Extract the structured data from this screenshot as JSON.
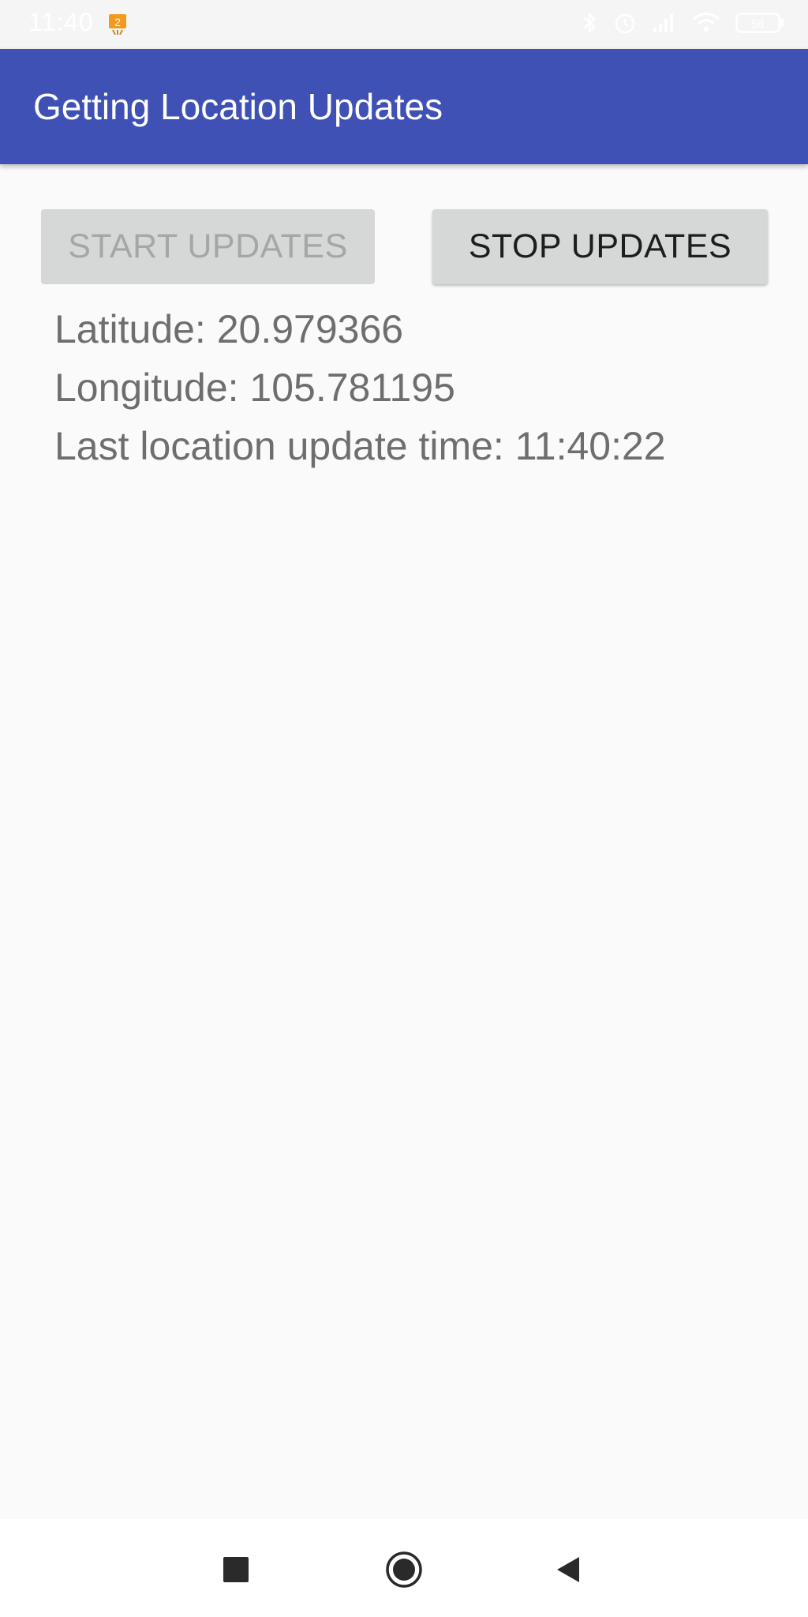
{
  "status_bar": {
    "time": "11:40",
    "notification_badge": "2",
    "icons": [
      "bluetooth-icon",
      "alarm-icon",
      "signal-icon",
      "wifi-icon",
      "battery-icon"
    ],
    "battery": "58"
  },
  "app_bar": {
    "title": "Getting Location Updates",
    "color": "#3f51b5"
  },
  "buttons": {
    "start_label": "START UPDATES",
    "start_enabled": false,
    "stop_label": "STOP UPDATES",
    "stop_enabled": true
  },
  "location": {
    "latitude_text": "Latitude: 20.979366",
    "longitude_text": "Longitude: 105.781195",
    "last_update_text": "Last location update time: 11:40:22"
  },
  "nav_bar": {
    "icons": [
      "recents-icon",
      "home-icon",
      "back-icon"
    ]
  }
}
